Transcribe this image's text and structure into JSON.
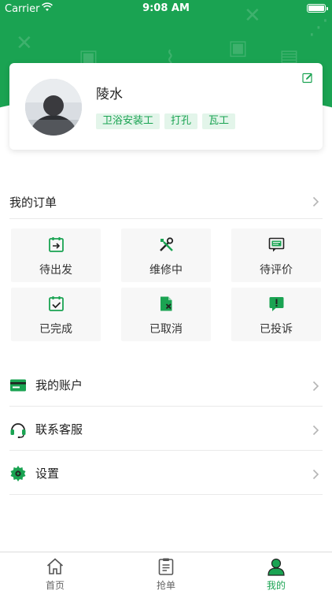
{
  "status_bar": {
    "carrier": "Carrier",
    "time": "9:08 AM"
  },
  "profile": {
    "name": "陵水",
    "tags": [
      "卫浴安装工",
      "打孔",
      "瓦工"
    ]
  },
  "orders": {
    "title": "我的订单",
    "items": [
      {
        "label": "待出发",
        "icon": "calendar-arrow-icon"
      },
      {
        "label": "维修中",
        "icon": "tools-icon"
      },
      {
        "label": "待评价",
        "icon": "comment-icon"
      },
      {
        "label": "已完成",
        "icon": "calendar-check-icon"
      },
      {
        "label": "已取消",
        "icon": "document-cancel-icon"
      },
      {
        "label": "已投诉",
        "icon": "complaint-icon"
      }
    ]
  },
  "menu": [
    {
      "label": "我的账户",
      "icon": "card-icon"
    },
    {
      "label": "联系客服",
      "icon": "headset-icon"
    },
    {
      "label": "设置",
      "icon": "gear-icon"
    }
  ],
  "tabbar": [
    {
      "label": "首页",
      "icon": "home-icon",
      "active": false
    },
    {
      "label": "抢单",
      "icon": "clipboard-icon",
      "active": false
    },
    {
      "label": "我的",
      "icon": "user-icon",
      "active": true
    }
  ],
  "colors": {
    "brand": "#1aa352",
    "tag_bg": "#e3f5ea",
    "cell_bg": "#f7f7f7"
  }
}
